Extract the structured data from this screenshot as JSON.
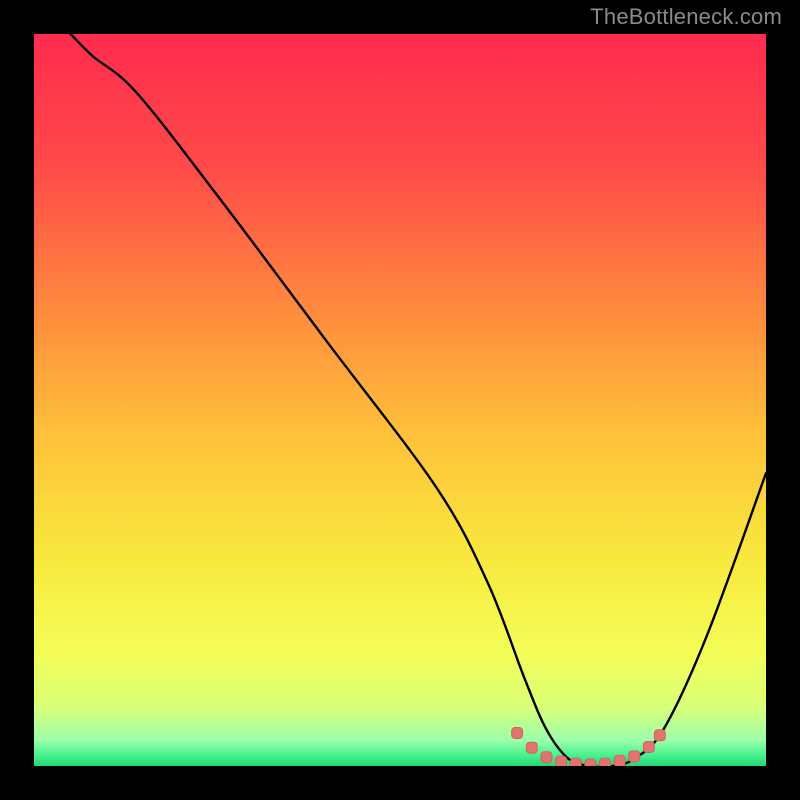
{
  "watermark": "TheBottleneck.com",
  "colors": {
    "gradient_stops": [
      {
        "offset": 0.0,
        "color": "#ff2b4e"
      },
      {
        "offset": 0.18,
        "color": "#ff4a49"
      },
      {
        "offset": 0.38,
        "color": "#ff8b3d"
      },
      {
        "offset": 0.55,
        "color": "#ffc23a"
      },
      {
        "offset": 0.72,
        "color": "#f8e93e"
      },
      {
        "offset": 0.85,
        "color": "#f3ff58"
      },
      {
        "offset": 0.92,
        "color": "#d8ff78"
      },
      {
        "offset": 0.965,
        "color": "#9bffab"
      },
      {
        "offset": 0.985,
        "color": "#48f28f"
      },
      {
        "offset": 1.0,
        "color": "#1fd973"
      }
    ],
    "curve": "#000000",
    "marker_fill": "#e2746f",
    "marker_stroke": "#d6625d"
  },
  "chart_data": {
    "type": "line",
    "title": "",
    "xlabel": "",
    "ylabel": "",
    "xlim": [
      0,
      100
    ],
    "ylim": [
      0,
      100
    ],
    "series": [
      {
        "name": "bottleneck-curve",
        "x": [
          5,
          8,
          14,
          25,
          40,
          55,
          62,
          67,
          70,
          73,
          76,
          79,
          82,
          86,
          92,
          100
        ],
        "y": [
          100,
          97,
          92,
          78,
          58,
          38,
          25,
          12,
          5,
          1,
          0,
          0,
          1,
          5,
          18,
          40
        ]
      }
    ],
    "markers": {
      "name": "optimal-range",
      "x": [
        66,
        68,
        70,
        72,
        74,
        76,
        78,
        80,
        82,
        84,
        85.5
      ],
      "y": [
        4.5,
        2.5,
        1.2,
        0.6,
        0.3,
        0.2,
        0.3,
        0.7,
        1.3,
        2.6,
        4.2
      ]
    }
  }
}
